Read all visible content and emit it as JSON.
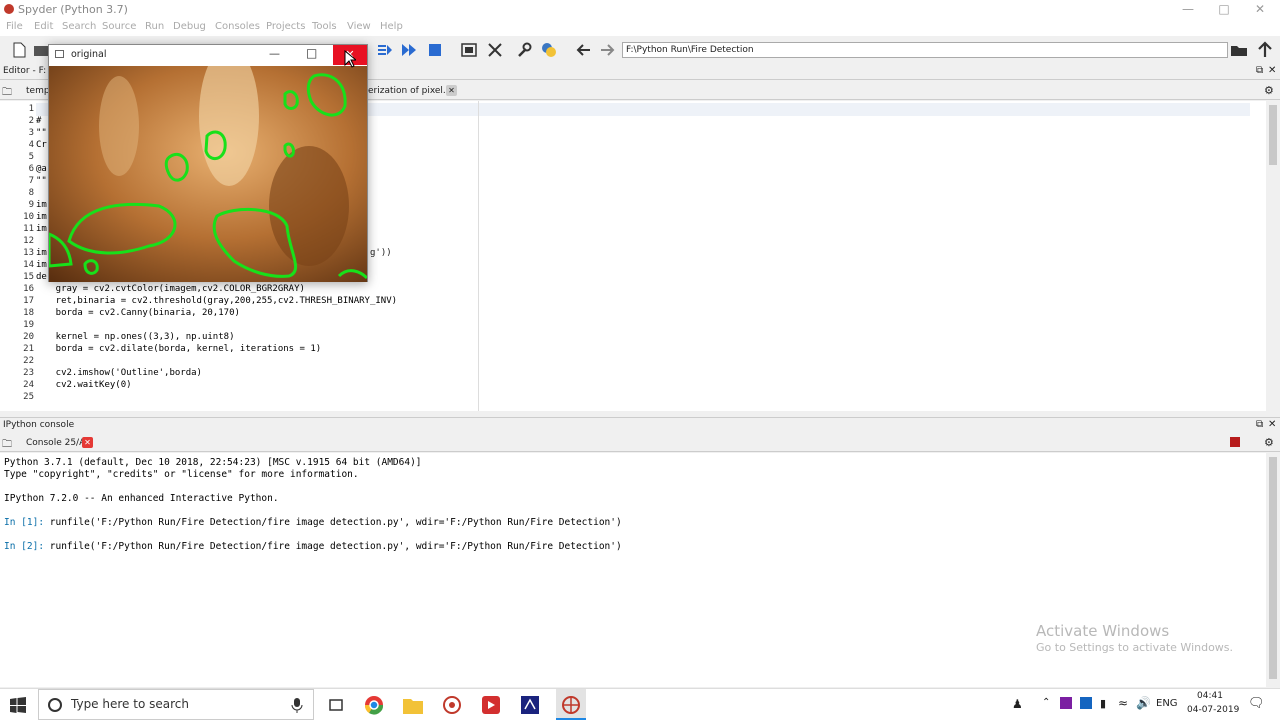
{
  "window": {
    "title": "Spyder (Python 3.7)"
  },
  "menu": [
    "File",
    "Edit",
    "Search",
    "Source",
    "Run",
    "Debug",
    "Consoles",
    "Projects",
    "Tools",
    "View",
    "Help"
  ],
  "toolbar": {
    "path": "F:\\Python Run\\Fire Detection"
  },
  "editor": {
    "header": "Editor - F:",
    "tabs": [
      "temp",
      "erization of pixel.py"
    ],
    "lines": [
      {
        "n": "1",
        "text": ""
      },
      {
        "n": "2",
        "text": "#"
      },
      {
        "n": "3",
        "text": "\"\""
      },
      {
        "n": "4",
        "text": "Cr"
      },
      {
        "n": "5",
        "text": ""
      },
      {
        "n": "6",
        "text": "@a"
      },
      {
        "n": "7",
        "text": "\"\""
      },
      {
        "n": "8",
        "text": ""
      },
      {
        "n": "9",
        "text": "im"
      },
      {
        "n": "10",
        "text": "im"
      },
      {
        "n": "11",
        "text": "im"
      },
      {
        "n": "12",
        "text": ""
      },
      {
        "n": "13",
        "text": "im"
      },
      {
        "n": "14",
        "text": "im"
      },
      {
        "n": "15",
        "text": "de"
      },
      {
        "n": "16",
        "text": "    gray = cv2.cvtColor(imagem,cv2.COLOR_BGR2GRAY)"
      },
      {
        "n": "17",
        "text": "    ret,binaria = cv2.threshold(gray,200,255,cv2.THRESH_BINARY_INV)"
      },
      {
        "n": "18",
        "text": "    borda = cv2.Canny(binaria, 20,170)"
      },
      {
        "n": "19",
        "text": ""
      },
      {
        "n": "20",
        "text": "    kernel = np.ones((3,3), np.uint8)"
      },
      {
        "n": "21",
        "text": "    borda = cv2.dilate(borda, kernel, iterations = 1)"
      },
      {
        "n": "22",
        "text": ""
      },
      {
        "n": "23",
        "text": "    cv2.imshow('Outline',borda)"
      },
      {
        "n": "24",
        "text": "    cv2.waitKey(0)"
      },
      {
        "n": "25",
        "text": ""
      }
    ],
    "fragment": "g'))"
  },
  "console": {
    "header": "IPython console",
    "tab": "Console 25/A",
    "lines": [
      "Python 3.7.1 (default, Dec 10 2018, 22:54:23) [MSC v.1915 64 bit (AMD64)]",
      "Type \"copyright\", \"credits\" or \"license\" for more information.",
      "",
      "IPython 7.2.0 -- An enhanced Interactive Python.",
      "",
      "In [1]: runfile('F:/Python Run/Fire Detection/fire image detection.py', wdir='F:/Python Run/Fire Detection')",
      "",
      "In [2]: runfile('F:/Python Run/Fire Detection/fire image detection.py', wdir='F:/Python Run/Fire Detection')"
    ]
  },
  "popup": {
    "title": "original"
  },
  "watermark": {
    "line1": "Activate Windows",
    "line2": "Go to Settings to activate Windows."
  },
  "taskbar": {
    "search_placeholder": "Type here to search",
    "lang": "ENG",
    "time": "04:41",
    "date": "04-07-2019"
  }
}
